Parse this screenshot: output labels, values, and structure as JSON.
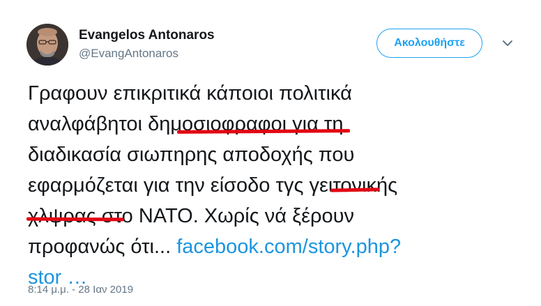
{
  "user": {
    "display_name": "Evangelos Antonaros",
    "handle": "@EvangAntonaros"
  },
  "follow_button": {
    "label": "Ακολουθήστε"
  },
  "tweet": {
    "line1": "Γραφουν επικριτικά κάποιοι πολιτικά",
    "line2_a": "αναλφάβητοι ",
    "line2_b": "δημοσιοφραφοι",
    "line2_c": " για τη",
    "line3": "διαδικασία σιωπηρης αποδοχής που",
    "line4_a": "εφαρμόζεται για την είσοδο ",
    "line4_b": "τγς",
    "line4_c": " γειτονικής",
    "line5_a": "χλψρας",
    "line5_b": " στο ΝΑΤΟ. Χωρίς νά ξέρουν",
    "line6_a": "προφανώς ότι... ",
    "link_part1": "facebook.com/story.php?",
    "link_part2": "stor",
    "ellipsis": " …"
  },
  "timestamp": "8:14 μ.μ. - 28 Ιαν 2019",
  "icons": {
    "caret": "chevron-down-icon"
  },
  "colors": {
    "link": "#1b95e0",
    "follow_accent": "#1da1f2",
    "underline_mark": "#e30613",
    "secondary_text": "#657786"
  }
}
